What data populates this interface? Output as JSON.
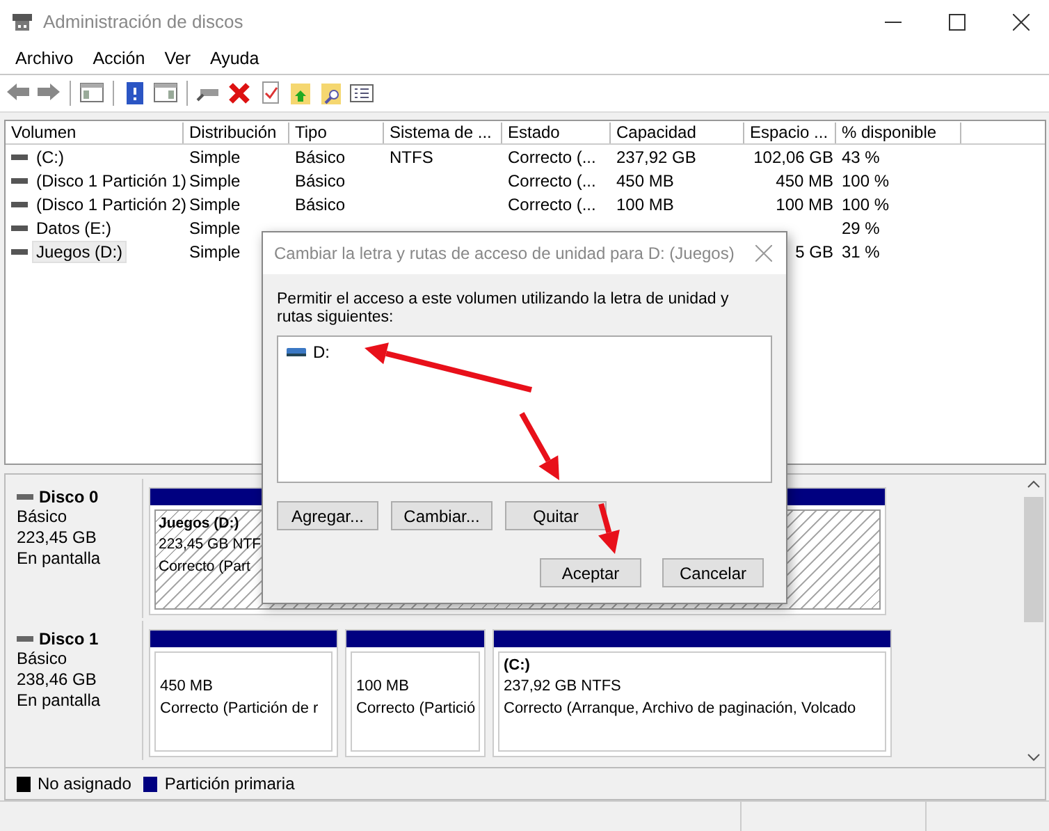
{
  "window": {
    "title": "Administración de discos"
  },
  "menu": [
    "Archivo",
    "Acción",
    "Ver",
    "Ayuda"
  ],
  "table": {
    "columns": [
      "Volumen",
      "Distribución",
      "Tipo",
      "Sistema de ...",
      "Estado",
      "Capacidad",
      "Espacio ...",
      "% disponible"
    ],
    "rows": [
      {
        "selected": false,
        "cells": [
          "(C:)",
          "Simple",
          "Básico",
          "NTFS",
          "Correcto (...",
          "237,92 GB",
          "102,06 GB",
          "43 %"
        ]
      },
      {
        "selected": false,
        "cells": [
          "(Disco 1 Partición 1)",
          "Simple",
          "Básico",
          null,
          "Correcto (...",
          "450 MB",
          "450 MB",
          "100 %"
        ]
      },
      {
        "selected": false,
        "cells": [
          "(Disco 1 Partición 2)",
          "Simple",
          "Básico",
          null,
          "Correcto (...",
          "100 MB",
          "100 MB",
          "100 %"
        ]
      },
      {
        "selected": false,
        "cells": [
          "Datos (E:)",
          "Simple",
          null,
          null,
          null,
          null,
          null,
          "29 %"
        ]
      },
      {
        "selected": true,
        "cells": [
          "Juegos (D:)",
          "Simple",
          null,
          null,
          null,
          null,
          "5 GB",
          "31 %"
        ]
      }
    ]
  },
  "disks": [
    {
      "name": "Disco 0",
      "type": "Básico",
      "size": "223,45 GB",
      "status": "En pantalla",
      "partitions": [
        {
          "title": "Juegos  (D:)",
          "size": "223,45 GB NTF",
          "status": "Correcto (Part",
          "selected": true
        }
      ]
    },
    {
      "name": "Disco 1",
      "type": "Básico",
      "size": "238,46 GB",
      "status": "En pantalla",
      "partitions": [
        {
          "size": "450 MB",
          "status": "Correcto (Partición de r",
          "selected": false
        },
        {
          "size": "100 MB",
          "status": "Correcto (Partició",
          "selected": false
        },
        {
          "title": "(C:)",
          "size": "237,92 GB NTFS",
          "status": "Correcto (Arranque, Archivo de paginación, Volcado",
          "selected": false
        }
      ]
    }
  ],
  "legend": [
    {
      "label": "No asignado",
      "color": "#000000"
    },
    {
      "label": "Partición primaria",
      "color": "#000080"
    }
  ],
  "dialog": {
    "title": "Cambiar la letra y rutas de acceso de unidad para D: (Juegos)",
    "prompt": "Permitir el acceso a este volumen utilizando la letra de unidad y rutas siguientes:",
    "paths": [
      {
        "label": "D:",
        "selected": false
      }
    ],
    "path_buttons": [
      "Agregar...",
      "Cambiar...",
      "Quitar"
    ],
    "action_buttons": [
      "Aceptar",
      "Cancelar"
    ]
  }
}
